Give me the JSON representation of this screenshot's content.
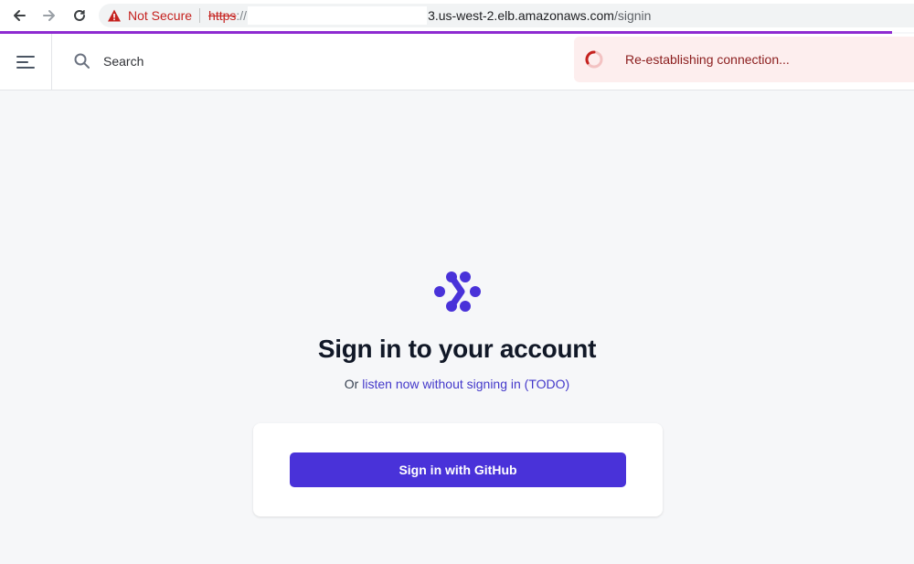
{
  "browser": {
    "security_label": "Not Secure",
    "url_scheme": "https",
    "url_scheme_slashes": "://",
    "url_host": "3.us-west-2.elb.amazonaws.com",
    "url_path": "/signin",
    "progress_color": "#8e2bd1"
  },
  "header": {
    "menu_icon": "hamburger-menu-icon",
    "search_icon": "search-icon",
    "search_placeholder": "Search"
  },
  "toast": {
    "message": "Re-establishing connection...",
    "icon": "spinner-icon",
    "background": "#fdeeee",
    "text_color": "#8b1d1d"
  },
  "signin": {
    "logo_icon": "app-logo-icon",
    "title": "Sign in to your account",
    "subtitle_prefix": "Or ",
    "subtitle_link": "listen now without signing in (TODO)",
    "github_button": "Sign in with GitHub",
    "accent_color": "#4932d9"
  }
}
